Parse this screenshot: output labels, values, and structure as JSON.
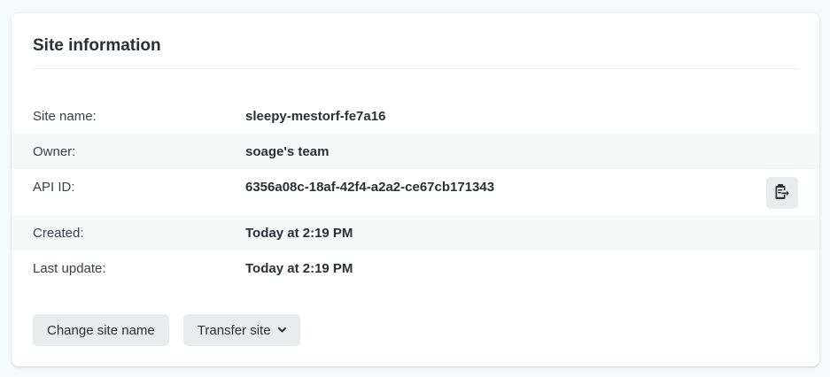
{
  "card": {
    "title": "Site information"
  },
  "rows": [
    {
      "label": "Site name:",
      "value": "sleepy-mestorf-fe7a16"
    },
    {
      "label": "Owner:",
      "value": "soage's team"
    },
    {
      "label": "API ID:",
      "value": "6356a08c-18af-42f4-a2a2-ce67cb171343",
      "icon": "copy-clipboard-icon"
    },
    {
      "label": "Created:",
      "value": "Today at 2:19 PM"
    },
    {
      "label": "Last update:",
      "value": "Today at 2:19 PM"
    }
  ],
  "actions": {
    "change_site_name": "Change site name",
    "transfer_site": "Transfer site",
    "transfer_icon": "chevron-down-icon"
  },
  "colors": {
    "background": "#f5fafa",
    "card": "#ffffff",
    "row_shade": "#f7f9f9",
    "button": "#e9ecec",
    "text": "#2b3034"
  }
}
